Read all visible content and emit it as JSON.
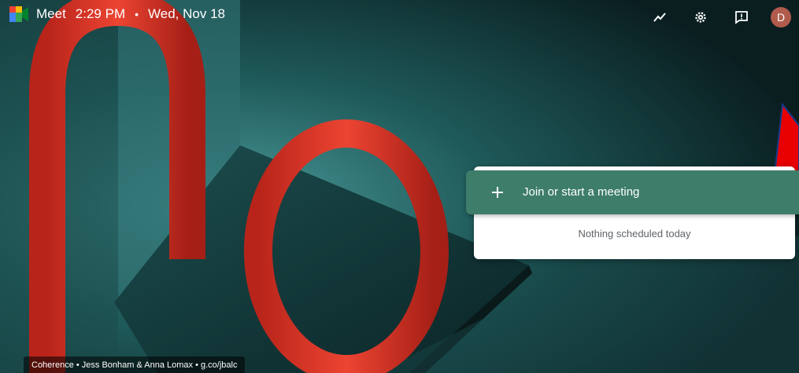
{
  "app": {
    "name": "Meet",
    "time": "2:29 PM",
    "separator": "•",
    "date": "Wed, Nov 18"
  },
  "toolbar": {
    "icons": [
      "activity-icon",
      "gear-icon",
      "feedback-icon"
    ],
    "avatar_initial": "D"
  },
  "meeting": {
    "join_label": "Join or start a meeting",
    "empty_text": "Nothing scheduled today"
  },
  "background_credit": "Coherence • Jess Bonham & Anna Lomax • g.co/jbalc",
  "colors": {
    "accent": "#3d7d6a",
    "avatar": "#b15b4d",
    "sculpture": "#e23b2b",
    "pointer": "#e80000"
  }
}
